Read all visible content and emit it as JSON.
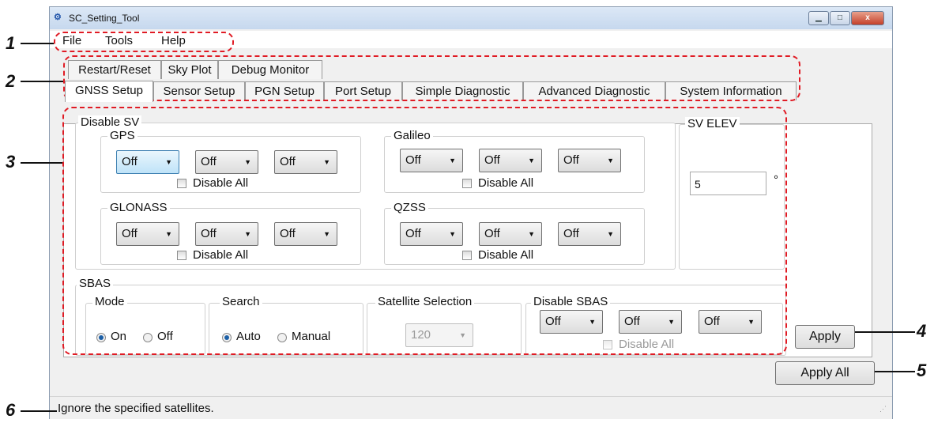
{
  "window": {
    "title": "SC_Setting_Tool",
    "minimize": "▁",
    "maximize": "□",
    "close": "x"
  },
  "menu": [
    "File",
    "Tools",
    "Help"
  ],
  "tabs_row1": [
    "Restart/Reset",
    "Sky Plot",
    "Debug Monitor"
  ],
  "tabs_row2": [
    "GNSS Setup",
    "Sensor Setup",
    "PGN Setup",
    "Port Setup",
    "Simple Diagnostic",
    "Advanced Diagnostic",
    "System Information"
  ],
  "disable_sv": {
    "title": "Disable SV",
    "groups": [
      {
        "name": "GPS",
        "values": [
          "Off",
          "Off",
          "Off"
        ],
        "disable_all": "Disable All"
      },
      {
        "name": "Galileo",
        "values": [
          "Off",
          "Off",
          "Off"
        ],
        "disable_all": "Disable All"
      },
      {
        "name": "GLONASS",
        "values": [
          "Off",
          "Off",
          "Off"
        ],
        "disable_all": "Disable All"
      },
      {
        "name": "QZSS",
        "values": [
          "Off",
          "Off",
          "Off"
        ],
        "disable_all": "Disable All"
      }
    ]
  },
  "sv_elev": {
    "title": "SV ELEV",
    "value": "5",
    "unit": "°"
  },
  "sbas": {
    "title": "SBAS",
    "mode": {
      "title": "Mode",
      "options": [
        "On",
        "Off"
      ],
      "selected": "On"
    },
    "search": {
      "title": "Search",
      "options": [
        "Auto",
        "Manual"
      ],
      "selected": "Auto"
    },
    "satellite_selection": {
      "title": "Satellite Selection",
      "value": "120"
    },
    "disable_sbas": {
      "title": "Disable SBAS",
      "values": [
        "Off",
        "Off",
        "Off"
      ],
      "disable_all": "Disable All"
    }
  },
  "buttons": {
    "apply": "Apply",
    "apply_all": "Apply All"
  },
  "status": "Ignore the specified satellites.",
  "callouts": [
    "1",
    "2",
    "3",
    "4",
    "5",
    "6"
  ],
  "colors": {
    "callout_dash": "#e01b24",
    "selection": "#1c5fa6",
    "title_bar": "#c6d8ee"
  }
}
